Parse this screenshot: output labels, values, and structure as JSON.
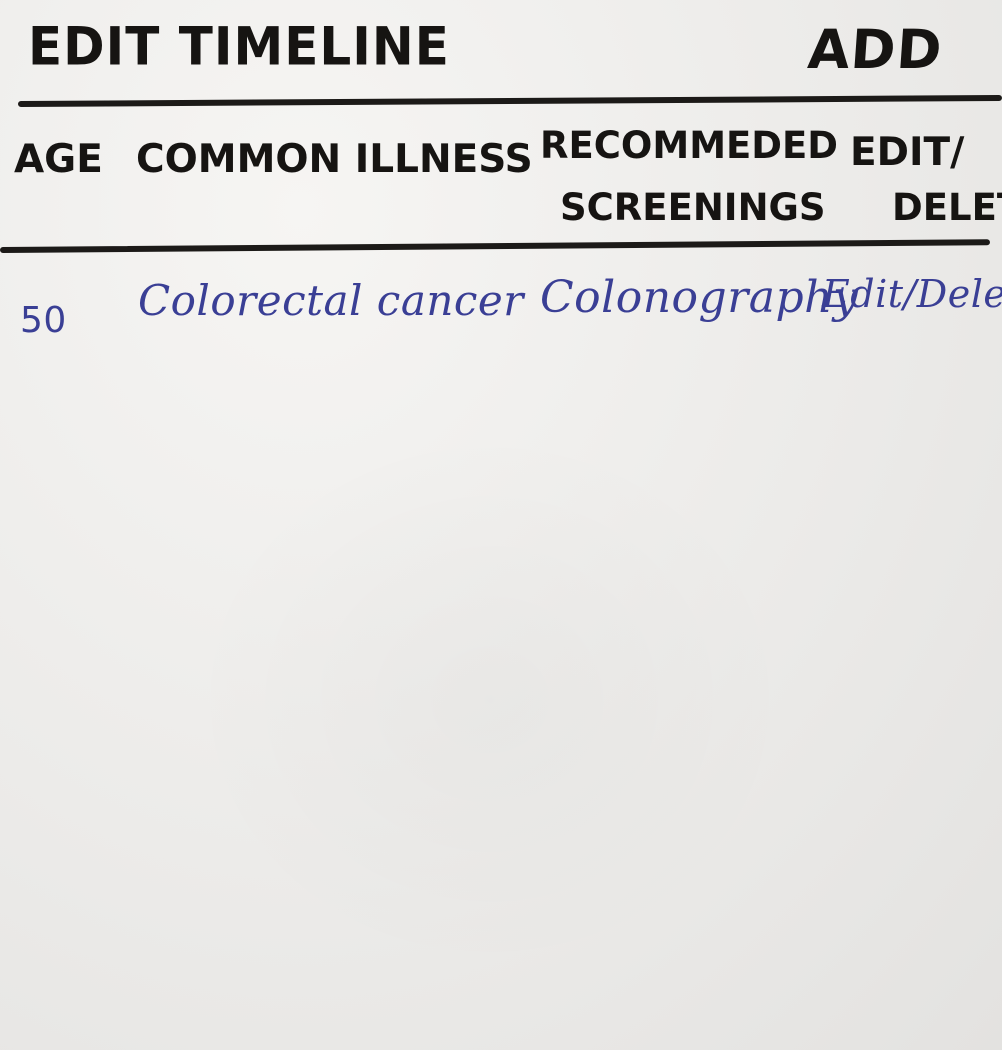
{
  "header": {
    "title": "EDIT TIMELINE",
    "add_label": "ADD"
  },
  "table": {
    "columns": [
      {
        "line1": "AGE",
        "line2": ""
      },
      {
        "line1": "COMMON ILLNESS",
        "line2": ""
      },
      {
        "line1": "RECOMMEDED",
        "line2": "SCREENINGS"
      },
      {
        "line1": "EDIT/",
        "line2": "DELETE"
      }
    ],
    "rows": [
      {
        "age": "50",
        "illness": "Colorectal cancer",
        "screening": "Colonography",
        "action": "Edit/Delete"
      }
    ]
  },
  "colors": {
    "marker": "#161412",
    "pen": "#3a3f95",
    "paper": "#ecebe9"
  }
}
